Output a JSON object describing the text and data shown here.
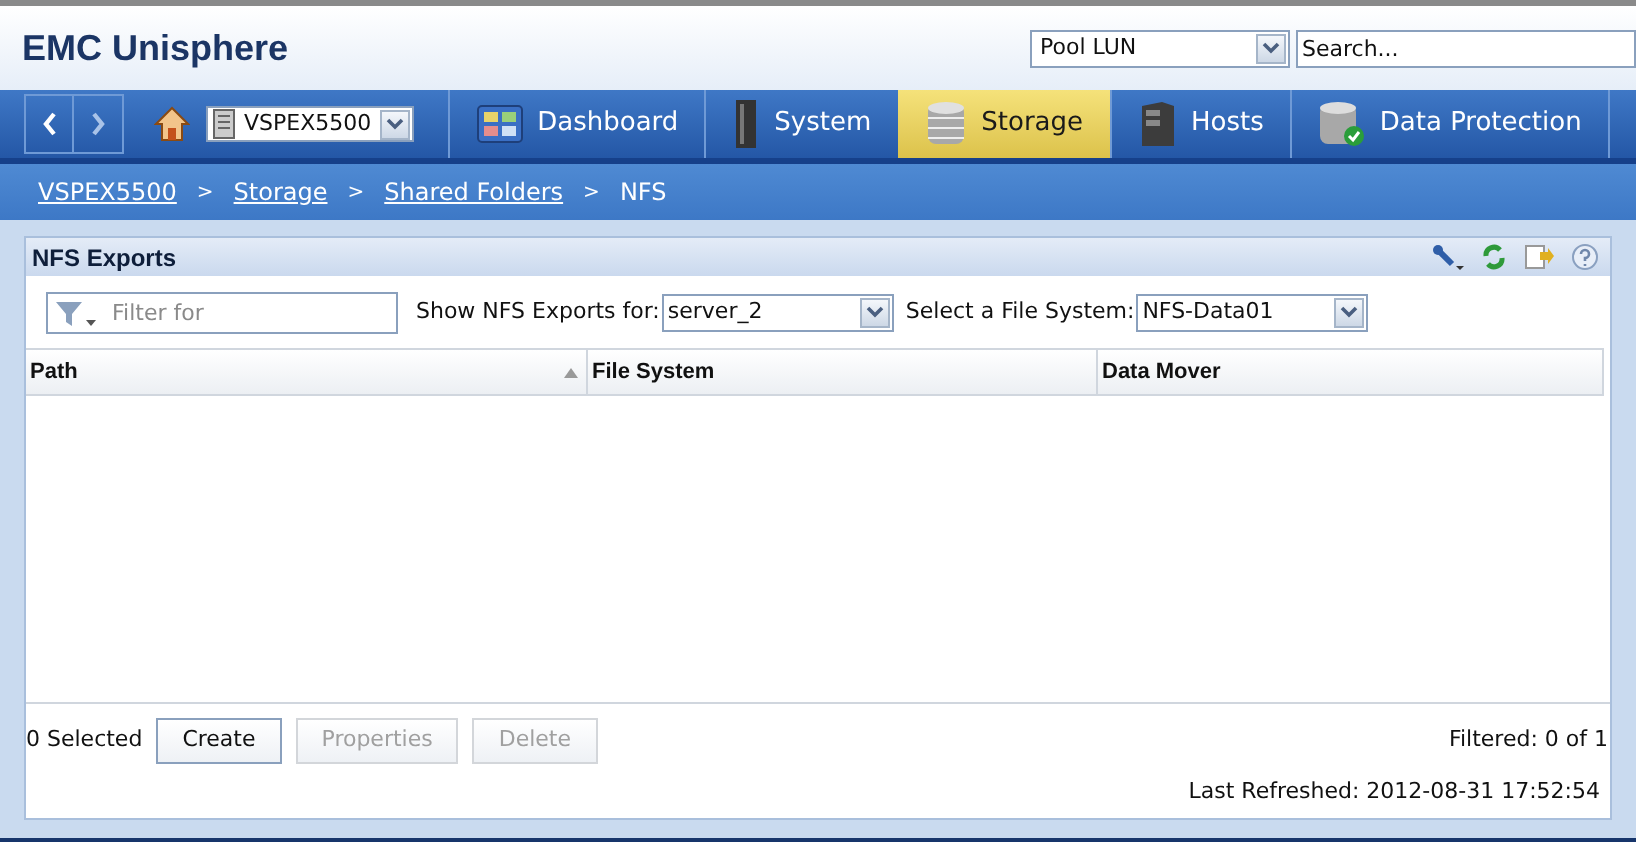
{
  "app_title": "EMC Unisphere",
  "search": {
    "scope": "Pool LUN",
    "placeholder": "Search..."
  },
  "system_select": "VSPEX5500",
  "nav_tabs": [
    {
      "label": "Dashboard",
      "kind": "dashboard",
      "selected": false
    },
    {
      "label": "System",
      "kind": "system",
      "selected": false
    },
    {
      "label": "Storage",
      "kind": "storage",
      "selected": true
    },
    {
      "label": "Hosts",
      "kind": "hosts",
      "selected": false
    },
    {
      "label": "Data Protection",
      "kind": "protection",
      "selected": false
    }
  ],
  "breadcrumb": [
    {
      "label": "VSPEX5500",
      "link": true
    },
    {
      "label": "Storage",
      "link": true
    },
    {
      "label": "Shared Folders",
      "link": true
    },
    {
      "label": "NFS",
      "link": false
    }
  ],
  "breadcrumb_separator": ">",
  "panel": {
    "title": "NFS Exports",
    "filter": {
      "placeholder": "Filter for"
    },
    "show_for": {
      "label": "Show NFS Exports for:",
      "value": "server_2"
    },
    "file_system": {
      "label": "Select a File System:",
      "value": "NFS-Data01"
    },
    "table": {
      "columns": [
        {
          "label": "Path",
          "sorted": true
        },
        {
          "label": "File System",
          "sorted": false
        },
        {
          "label": "Data Mover",
          "sorted": false
        }
      ]
    },
    "selected_count": "0 Selected",
    "buttons": [
      {
        "label": "Create",
        "disabled": false
      },
      {
        "label": "Properties",
        "disabled": true
      },
      {
        "label": "Delete",
        "disabled": true
      }
    ],
    "filtered": "Filtered: 0 of 1",
    "last_refreshed": "Last Refreshed: 2012-08-31 17:52:54"
  }
}
